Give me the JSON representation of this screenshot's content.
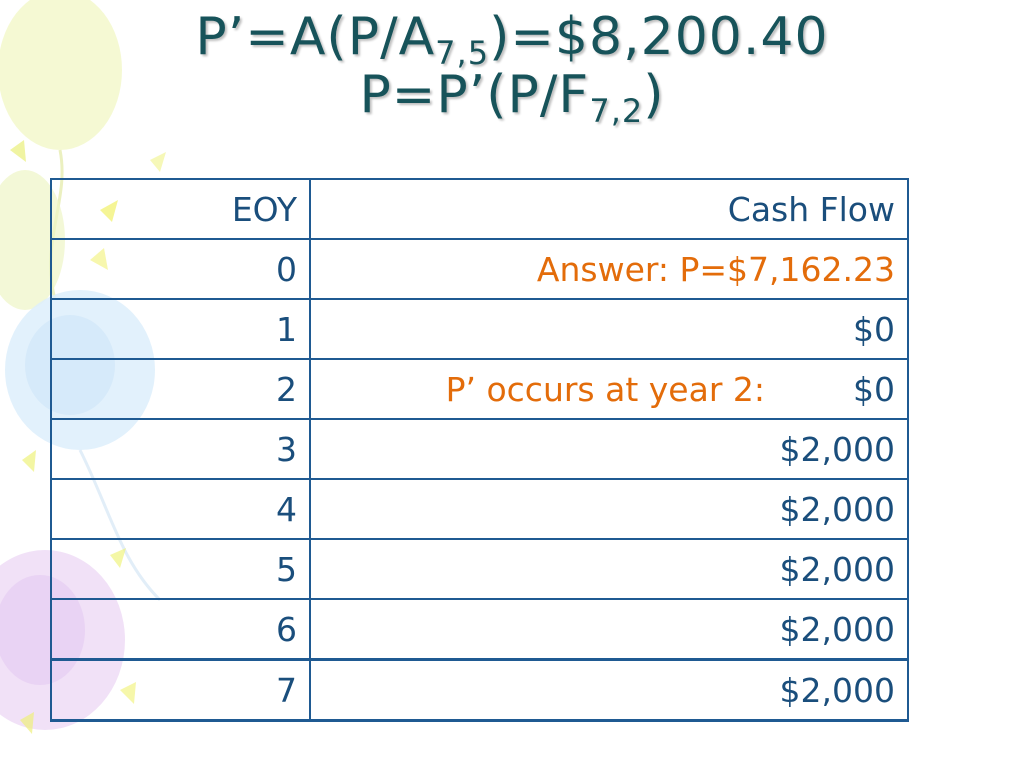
{
  "slide": {
    "title_line1": {
      "pre": "P’=A(P/A",
      "sub": "7,5",
      "post": ")=$8,200.40"
    },
    "title_line2": {
      "pre": "P=P’(P/F",
      "sub": "7,2",
      "post": ")"
    }
  },
  "table": {
    "headers": [
      "EOY",
      "Cash Flow"
    ],
    "rows": [
      {
        "eoy": "0",
        "cash": "Answer:  P=$7,162.23"
      },
      {
        "eoy": "1",
        "cash": "$0"
      },
      {
        "eoy": "2",
        "note": "P’ occurs at year 2:",
        "cash": "$0"
      },
      {
        "eoy": "3",
        "cash": "$2,000"
      },
      {
        "eoy": "4",
        "cash": "$2,000"
      },
      {
        "eoy": "5",
        "cash": "$2,000"
      },
      {
        "eoy": "6",
        "cash": "$2,000"
      },
      {
        "eoy": "7",
        "cash": "$2,000"
      }
    ]
  },
  "colors": {
    "title": "#17535a",
    "table_text": "#1a4e7c",
    "accent": "#e36c0a",
    "border": "#1f5a92"
  },
  "background": {
    "decoration": "balloons"
  }
}
